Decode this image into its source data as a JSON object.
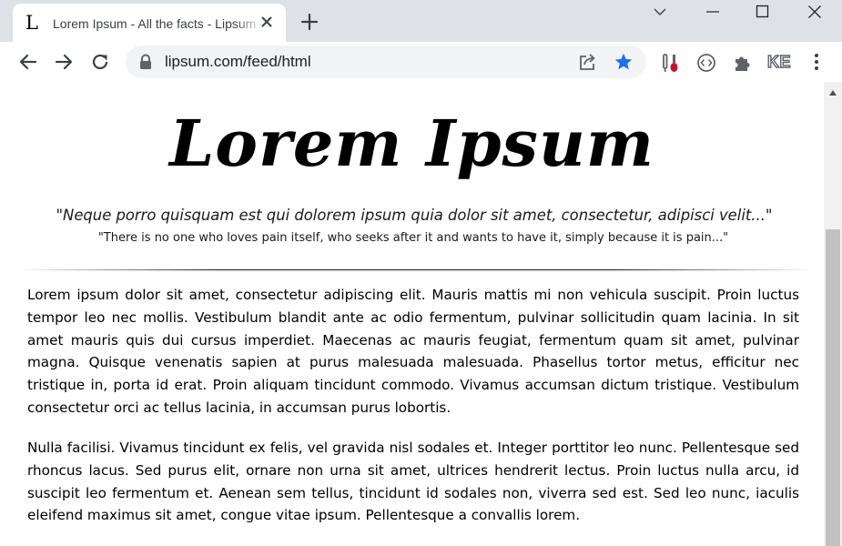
{
  "browser": {
    "tab": {
      "favicon_letter": "L",
      "title": "Lorem Ipsum - All the facts - Lipsum generator"
    },
    "address_bar": {
      "url": "lipsum.com/feed/html"
    },
    "profile_initials": "KE",
    "icons": {
      "close_tab": "close-icon",
      "new_tab": "plus-icon",
      "back": "arrow-left-icon",
      "forward": "arrow-right-icon",
      "reload": "reload-icon",
      "lock": "lock-icon",
      "share": "share-icon",
      "bookmark": "star-icon",
      "extension_1": "tools-icon",
      "extension_2": "code-icon",
      "extensions": "puzzle-icon",
      "menu": "kebab-menu-icon"
    },
    "colors": {
      "tabstrip": "#dee1e6",
      "accent": "#1a73e8",
      "icon": "#5f6368"
    }
  },
  "page": {
    "title": "Lorem Ipsum",
    "quote_latin": "\"Neque porro quisquam est qui dolorem ipsum quia dolor sit amet, consectetur, adipisci velit...\"",
    "quote_english": "\"There is no one who loves pain itself, who seeks after it and wants to have it, simply because it is pain...\"",
    "paragraphs": [
      "Lorem ipsum dolor sit amet, consectetur adipiscing elit. Mauris mattis mi non vehicula suscipit. Proin luctus tempor leo nec mollis. Vestibulum blandit ante ac odio fermentum, pulvinar sollicitudin quam lacinia. In sit amet mauris quis dui cursus imperdiet. Maecenas ac mauris feugiat, fermentum quam sit amet, pulvinar magna. Quisque venenatis sapien at purus malesuada malesuada. Phasellus tortor metus, efficitur nec tristique in, porta id erat. Proin aliquam tincidunt commodo. Vivamus accumsan dictum tristique. Vestibulum consectetur orci ac tellus lacinia, in accumsan purus lobortis.",
      "Nulla facilisi. Vivamus tincidunt ex felis, vel gravida nisl sodales et. Integer porttitor leo nunc. Pellentesque sed rhoncus lacus. Sed purus elit, ornare non urna sit amet, ultrices hendrerit lectus. Proin luctus nulla arcu, id suscipit leo fermentum et. Aenean sem tellus, tincidunt id sodales non, viverra sed est. Sed leo nunc, iaculis eleifend maximus sit amet, congue vitae ipsum. Pellentesque a convallis lorem."
    ]
  }
}
